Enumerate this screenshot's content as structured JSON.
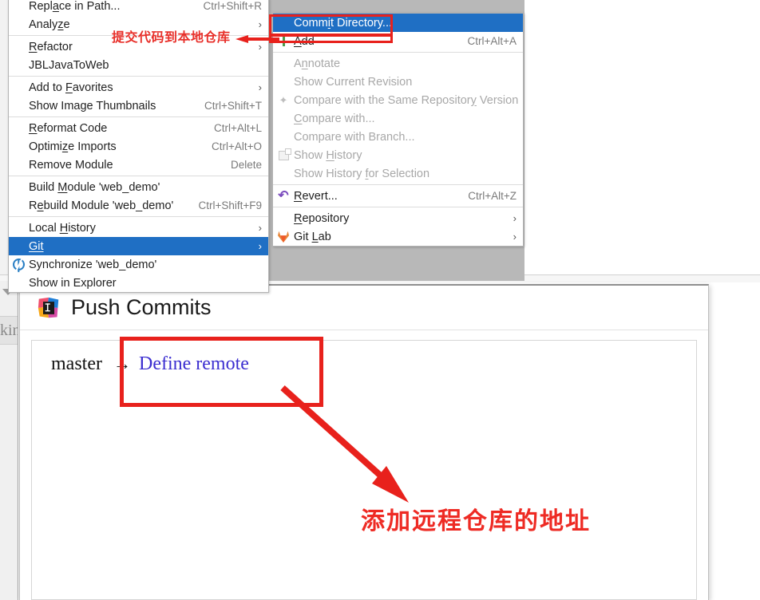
{
  "context_menu": {
    "name": "editor-context-menu",
    "items": [
      {
        "label": "Replace in Path...",
        "accel": "Ctrl+Shift+R",
        "mnemonic_index": 4,
        "type": "item"
      },
      {
        "label": "Analyze",
        "accel": "",
        "submenu": true,
        "mnemonic_index": 6,
        "type": "item"
      },
      {
        "type": "separator"
      },
      {
        "label": "Refactor",
        "accel": "",
        "submenu": true,
        "mnemonic_index": 0,
        "type": "item"
      },
      {
        "label": "JBLJavaToWeb",
        "accel": "",
        "type": "item"
      },
      {
        "type": "separator"
      },
      {
        "label": "Add to Favorites",
        "accel": "",
        "submenu": true,
        "mnemonic_index": 7,
        "type": "item"
      },
      {
        "label": "Show Image Thumbnails",
        "accel": "Ctrl+Shift+T",
        "type": "item"
      },
      {
        "type": "separator"
      },
      {
        "label": "Reformat Code",
        "accel": "Ctrl+Alt+L",
        "mnemonic_index": 0,
        "type": "item"
      },
      {
        "label": "Optimize Imports",
        "accel": "Ctrl+Alt+O",
        "mnemonic_index": 5,
        "type": "item"
      },
      {
        "label": "Remove Module",
        "accel": "Delete",
        "type": "item"
      },
      {
        "type": "separator"
      },
      {
        "label": "Build Module 'web_demo'",
        "accel": "",
        "mnemonic_index": 6,
        "type": "item"
      },
      {
        "label": "Rebuild Module 'web_demo'",
        "accel": "Ctrl+Shift+F9",
        "mnemonic_index": 2,
        "type": "item"
      },
      {
        "type": "separator"
      },
      {
        "label": "Local History",
        "accel": "",
        "submenu": true,
        "mnemonic_index": 6,
        "type": "item"
      },
      {
        "label": "Git",
        "accel": "",
        "submenu": true,
        "selected": true,
        "mnemonic_index": 0,
        "type": "item"
      },
      {
        "label": "Synchronize 'web_demo'",
        "accel": "",
        "icon": "sync-icon",
        "type": "item"
      },
      {
        "label": "Show in Explorer",
        "accel": "",
        "type": "item"
      }
    ]
  },
  "git_submenu": {
    "name": "git-submenu",
    "items": [
      {
        "label": "Commit Directory...",
        "accel": "",
        "selected": true,
        "mnemonic_index": 6,
        "type": "item"
      },
      {
        "label": "Add",
        "accel": "Ctrl+Alt+A",
        "icon": "add-icon",
        "mnemonic_index": 0,
        "type": "item"
      },
      {
        "type": "separator"
      },
      {
        "label": "Annotate",
        "accel": "",
        "disabled": true,
        "mnemonic_index": 1,
        "type": "item"
      },
      {
        "label": "Show Current Revision",
        "accel": "",
        "disabled": true,
        "type": "item"
      },
      {
        "label": "Compare with the Same Repository Version",
        "accel": "",
        "disabled": true,
        "icon": "compare-icon",
        "mnemonic_index": 33,
        "type": "item"
      },
      {
        "label": "Compare with...",
        "accel": "",
        "disabled": true,
        "mnemonic_index": 0,
        "type": "item"
      },
      {
        "label": "Compare with Branch...",
        "accel": "",
        "disabled": true,
        "type": "item"
      },
      {
        "label": "Show History",
        "accel": "",
        "disabled": true,
        "icon": "history-icon",
        "mnemonic_index": 5,
        "type": "item"
      },
      {
        "label": "Show History for Selection",
        "accel": "",
        "disabled": true,
        "mnemonic_index": 13,
        "type": "item"
      },
      {
        "type": "separator"
      },
      {
        "label": "Revert...",
        "accel": "Ctrl+Alt+Z",
        "icon": "revert-icon",
        "mnemonic_index": 0,
        "type": "item"
      },
      {
        "type": "separator"
      },
      {
        "label": "Repository",
        "accel": "",
        "submenu": true,
        "mnemonic_index": 0,
        "type": "item"
      },
      {
        "label": "Git Lab",
        "accel": "",
        "submenu": true,
        "icon": "gitlab-icon",
        "mnemonic_index": 4,
        "type": "item"
      }
    ]
  },
  "dialog": {
    "name": "push-commits-dialog",
    "title": "Push Commits",
    "icon": "intellij-idea-logo",
    "push_row": {
      "branch": "master",
      "arrow": "→",
      "remote_link": "Define remote"
    }
  },
  "annotations": {
    "top_note": "提交代码到本地仓库",
    "bottom_note": "添加远程仓库的地址",
    "color": "#e8211c"
  },
  "ide_sidebar": {
    "tab_label": "kin",
    "collapse_icon": "triangle-down-icon"
  }
}
